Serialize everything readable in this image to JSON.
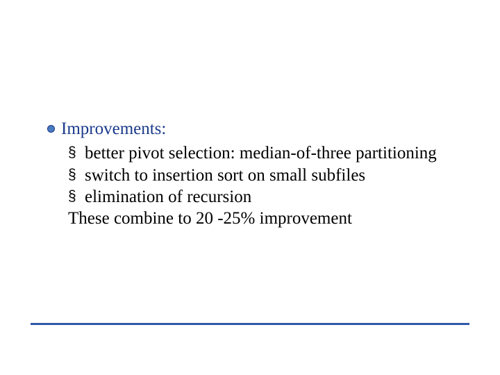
{
  "slide": {
    "level1_heading": "Improvements:",
    "items": [
      "better pivot selection: median-of-three partitioning",
      "switch to insertion sort on small subfiles",
      "elimination of recursion"
    ],
    "summary": "These combine to 20 -25% improvement",
    "colors": {
      "accent": "#2f5aa8",
      "heading": "#1a3a8a",
      "body": "#000000"
    }
  }
}
